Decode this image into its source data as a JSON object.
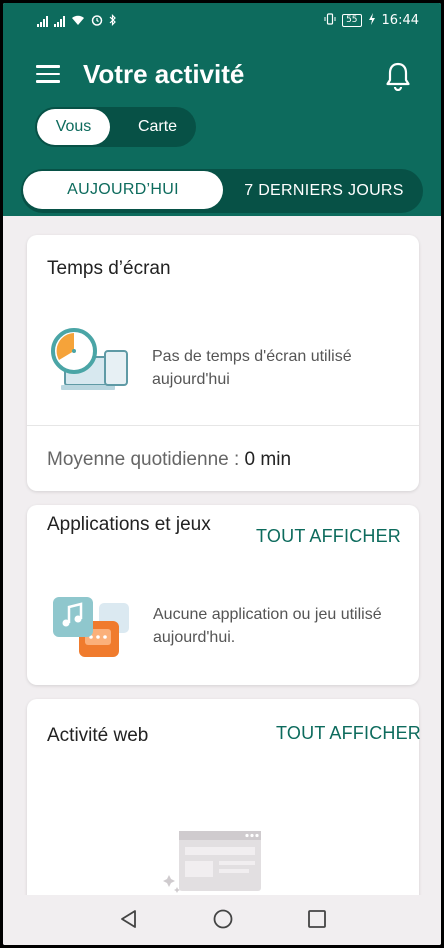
{
  "status_bar": {
    "time": "16:44",
    "battery": "55",
    "signal_icon": "signal-icon",
    "wifi_icon": "wifi-icon",
    "alarm_icon": "alarm-icon",
    "bluetooth_icon": "bluetooth-icon",
    "vibrate_icon": "vibrate-icon"
  },
  "header": {
    "title": "Votre activité",
    "segmented": {
      "options": [
        "Vous",
        "Carte"
      ],
      "selected": "Vous"
    },
    "range_tabs": {
      "options": [
        "AUJOURD’HUI",
        "7 DERNIERS JOURS"
      ],
      "selected": "AUJOURD’HUI"
    }
  },
  "cards": {
    "screen_time": {
      "title": "Temps d’écran",
      "empty": "Pas de temps d'écran utilisé aujourd'hui",
      "avg_label": "Moyenne quotidienne :",
      "avg_value": "0 min"
    },
    "apps": {
      "title": "Applications et jeux",
      "link": "TOUT AFFICHER",
      "empty": "Aucune application ou jeu utilisé aujourd'hui."
    },
    "web": {
      "title": "Activité web",
      "link": "TOUT AFFICHER"
    }
  },
  "colors": {
    "primary": "#0d6b5d",
    "primary_dark": "#075146",
    "background": "#f1eef0",
    "accent_orange": "#f5a33a"
  }
}
